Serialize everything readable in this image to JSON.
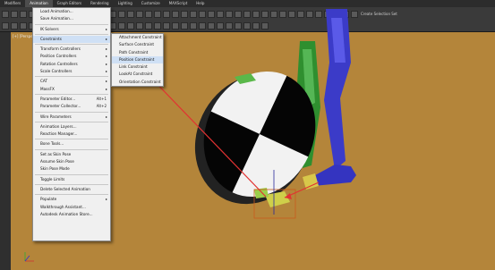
{
  "menubar": {
    "items": [
      "Modifiers",
      "Animation",
      "Graph Editors",
      "Rendering",
      "Lighting",
      "Customize",
      "MAXScript",
      "Help"
    ],
    "active_index": 1
  },
  "toolbar": {
    "labels": [
      "Create Selection Set"
    ]
  },
  "viewport": {
    "label": "[+] [Perspective] [Shaded]"
  },
  "animation_menu": {
    "items": [
      {
        "label": "Load Animation...",
        "sub": false
      },
      {
        "label": "Save Animation...",
        "sub": false
      },
      {
        "sep": true
      },
      {
        "label": "IK Solvers",
        "sub": true
      },
      {
        "sep": true
      },
      {
        "label": "Constraints",
        "sub": true,
        "highlight": true
      },
      {
        "sep": true
      },
      {
        "label": "Transform Controllers",
        "sub": true
      },
      {
        "label": "Position Controllers",
        "sub": true
      },
      {
        "label": "Rotation Controllers",
        "sub": true
      },
      {
        "label": "Scale Controllers",
        "sub": true
      },
      {
        "sep": true
      },
      {
        "label": "CAT",
        "sub": true
      },
      {
        "label": "MassFX",
        "sub": true
      },
      {
        "sep": true
      },
      {
        "label": "Parameter Editor...",
        "shortcut": "Alt+1"
      },
      {
        "label": "Parameter Collector...",
        "shortcut": "Alt+2"
      },
      {
        "sep": true
      },
      {
        "label": "Wire Parameters",
        "sub": true
      },
      {
        "sep": true
      },
      {
        "label": "Animation Layers..."
      },
      {
        "label": "Reaction Manager..."
      },
      {
        "sep": true
      },
      {
        "label": "Bone Tools..."
      },
      {
        "sep": true
      },
      {
        "label": "Set as Skin Pose"
      },
      {
        "label": "Assume Skin Pose"
      },
      {
        "label": "Skin Pose Mode"
      },
      {
        "sep": true
      },
      {
        "label": "Toggle Limits"
      },
      {
        "sep": true
      },
      {
        "label": "Delete Selected Animation"
      },
      {
        "sep": true
      },
      {
        "label": "Populate",
        "sub": true
      },
      {
        "label": "Walkthrough Assistant..."
      },
      {
        "label": "Autodesk Animation Store..."
      }
    ]
  },
  "constraints_menu": {
    "items": [
      {
        "label": "Attachment Constraint"
      },
      {
        "label": "Surface Constraint"
      },
      {
        "label": "Path Constraint"
      },
      {
        "label": "Position Constraint",
        "highlight": true
      },
      {
        "label": "Link Constraint"
      },
      {
        "label": "LookAt Constraint"
      },
      {
        "label": "Orientation Constraint"
      }
    ]
  }
}
